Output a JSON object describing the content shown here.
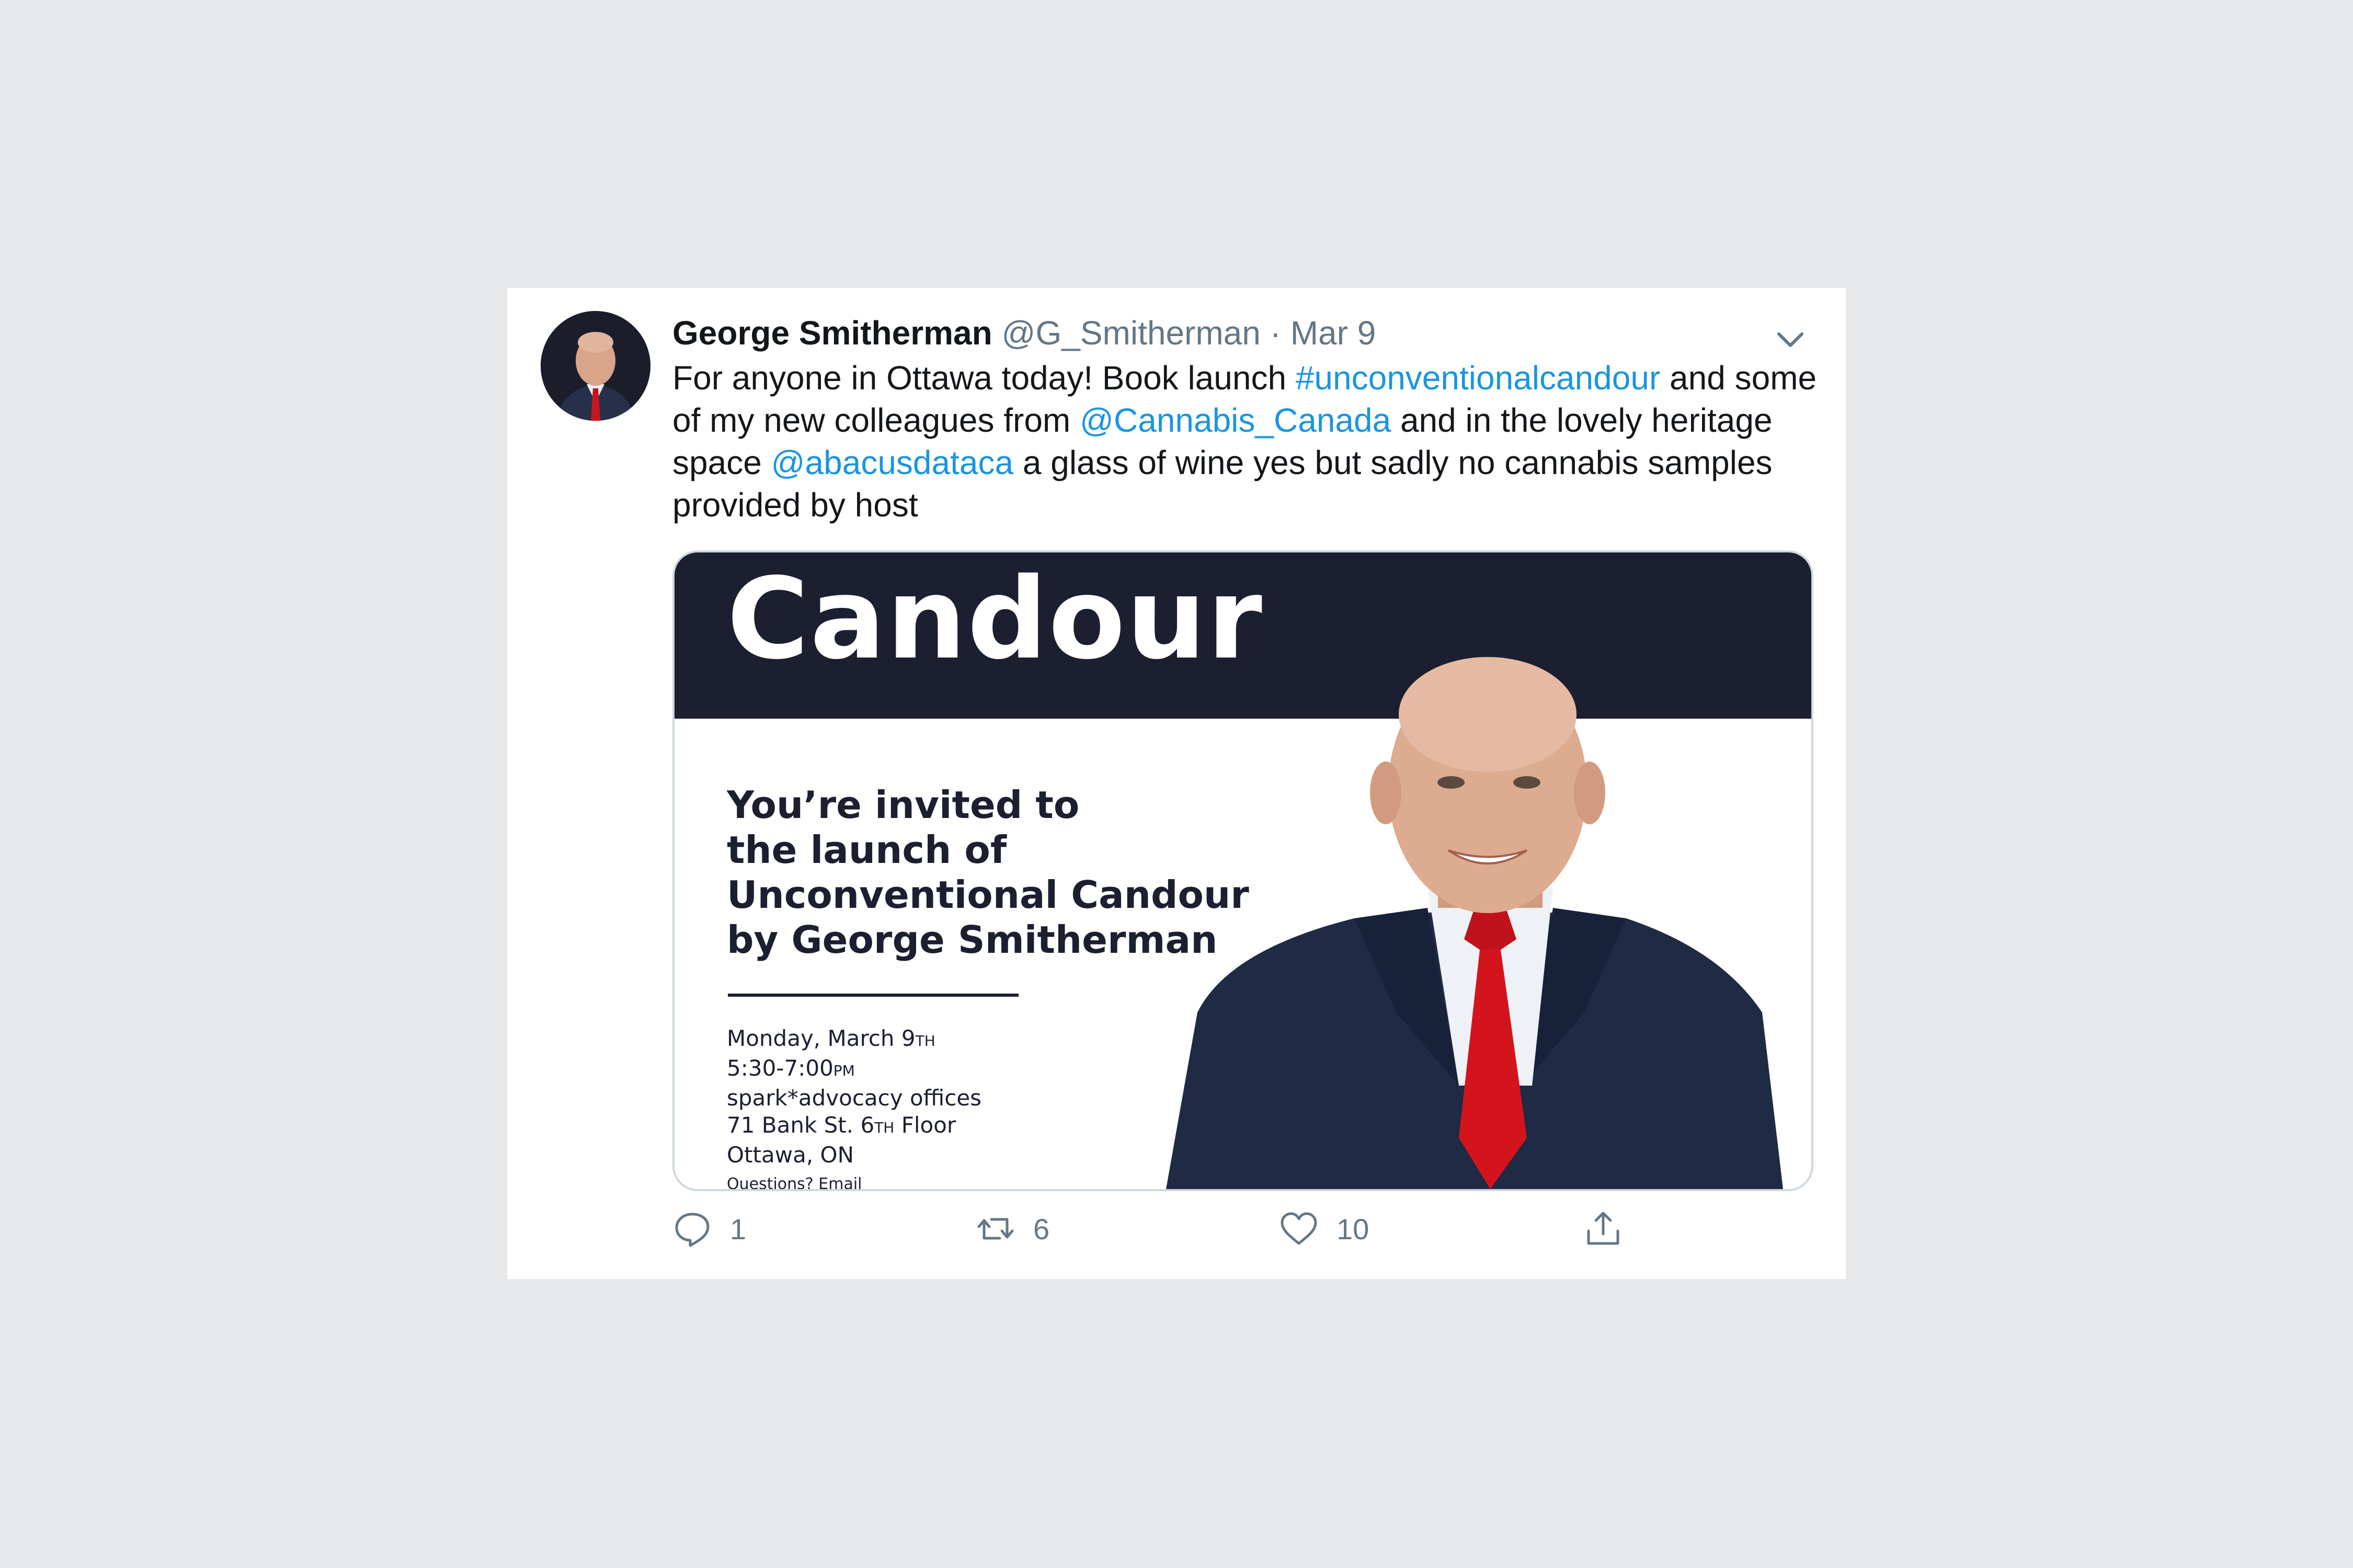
{
  "tweet": {
    "display_name": "George Smitherman",
    "handle": "@G_Smitherman",
    "separator": "·",
    "date": "Mar 9",
    "text": {
      "p1": "For anyone in Ottawa today! Book launch ",
      "hashtag": "#unconventionalcandour",
      "p2": " and some of my new colleagues from ",
      "mention1": "@Cannabis_Canada",
      "p3": " and in the lovely heritage space ",
      "mention2": "@abacusdataca",
      "p4": " a glass of wine yes but sadly no cannabis samples provided by host"
    }
  },
  "media": {
    "banner_title": "Candour",
    "invite_lines": [
      "You’re invited to",
      "the launch of",
      "Unconventional Candour",
      "by George Smitherman"
    ],
    "details": {
      "date": "Monday, March 9",
      "date_suffix": "TH",
      "time": "5:30-7:00",
      "time_suffix": "PM",
      "venue": "spark*advocacy offices",
      "address_a": "71 Bank St. 6",
      "address_suffix": "TH",
      "address_b": " Floor",
      "city": "Ottawa, ON",
      "cutoff": "Questions? Email"
    }
  },
  "actions": {
    "replies": "1",
    "retweets": "6",
    "likes": "10"
  },
  "colors": {
    "link": "#1b95e0",
    "banner": "#1c1f2f",
    "muted": "#657786"
  },
  "icons": [
    "chevron-down-icon",
    "reply-icon",
    "retweet-icon",
    "like-icon",
    "share-icon"
  ]
}
